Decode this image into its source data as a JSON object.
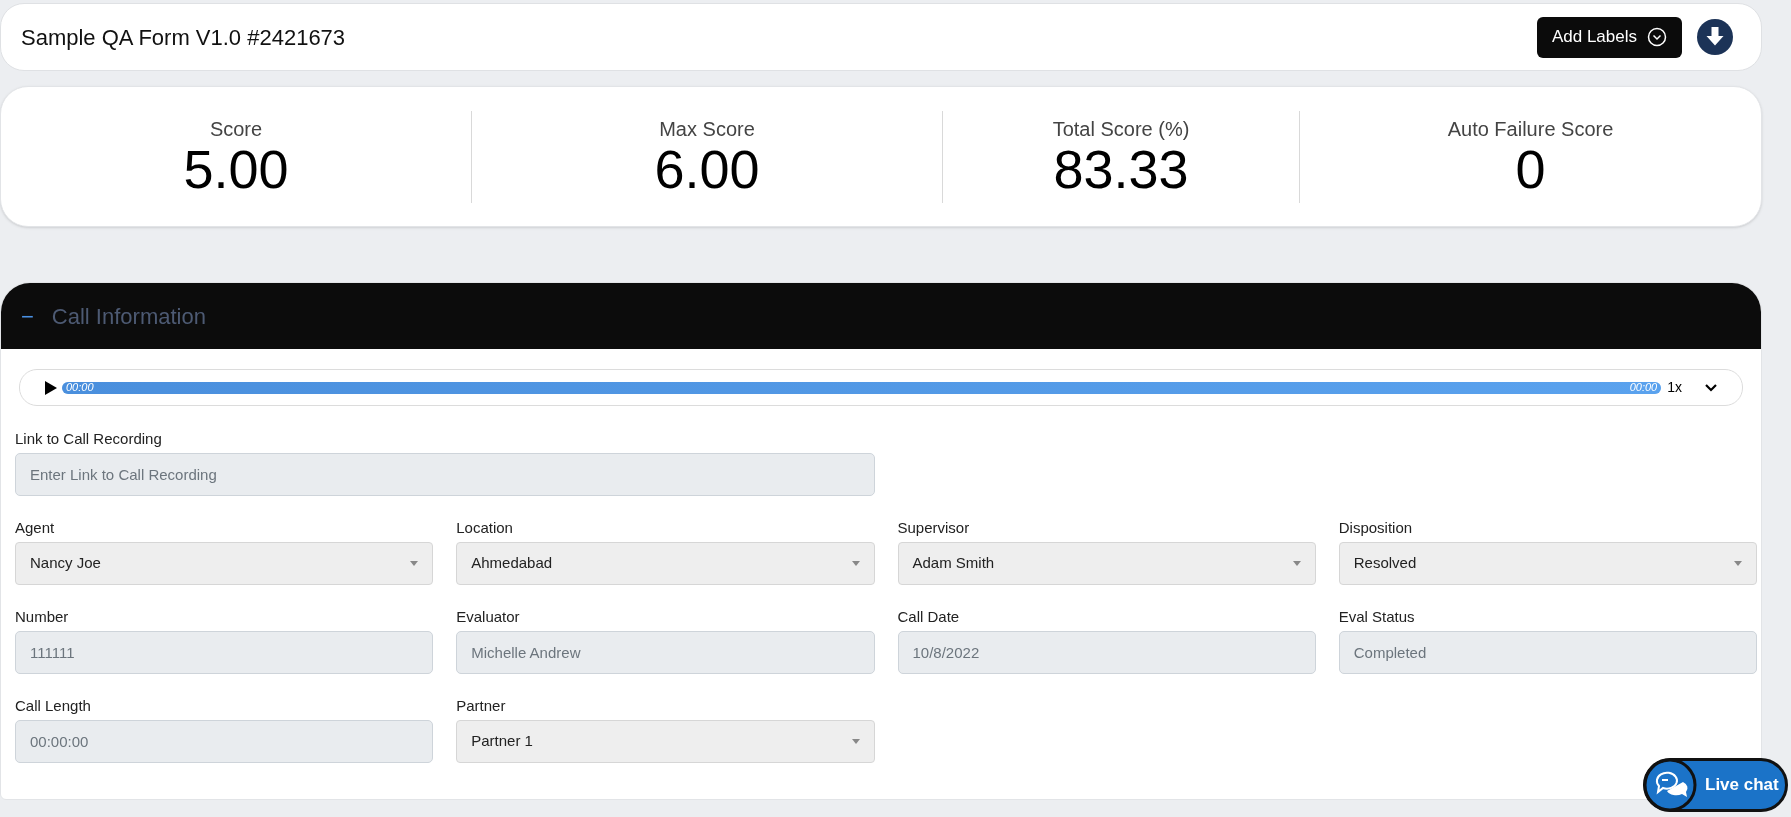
{
  "header": {
    "title": "Sample QA Form V1.0 #2421673",
    "add_labels_button": "Add Labels"
  },
  "scores": [
    {
      "label": "Score",
      "value": "5.00"
    },
    {
      "label": "Max Score",
      "value": "6.00"
    },
    {
      "label": "Total Score (%)",
      "value": "83.33"
    },
    {
      "label": "Auto Failure Score",
      "value": "0"
    }
  ],
  "section": {
    "toggle": "−",
    "title": "Call Information",
    "expanded": true,
    "player": {
      "level": 1,
      "current_time": "00:00",
      "duration": "00:00",
      "speed": "1x"
    },
    "link_field": {
      "label": "Link to Call Recording",
      "placeholder": "Enter Link to Call Recording"
    },
    "fields": [
      {
        "label": "Agent",
        "kind": "select",
        "value": "Nancy Joe"
      },
      {
        "label": "Location",
        "kind": "select",
        "value": "Ahmedabad"
      },
      {
        "label": "Supervisor",
        "kind": "select",
        "value": "Adam Smith"
      },
      {
        "label": "Disposition",
        "kind": "select",
        "value": "Resolved"
      },
      {
        "label": "Number",
        "kind": "text",
        "value": "111111"
      },
      {
        "label": "Evaluator",
        "kind": "text",
        "value": "Michelle Andrew"
      },
      {
        "label": "Call Date",
        "kind": "text",
        "value": "10/8/2022"
      },
      {
        "label": "Eval Status",
        "kind": "text",
        "value": "Completed"
      },
      {
        "label": "Call Length",
        "kind": "text",
        "value": "00:00:00"
      },
      {
        "label": "Partner",
        "kind": "select",
        "value": "Partner 1"
      }
    ]
  },
  "live_chat": {
    "label": "Live chat"
  }
}
